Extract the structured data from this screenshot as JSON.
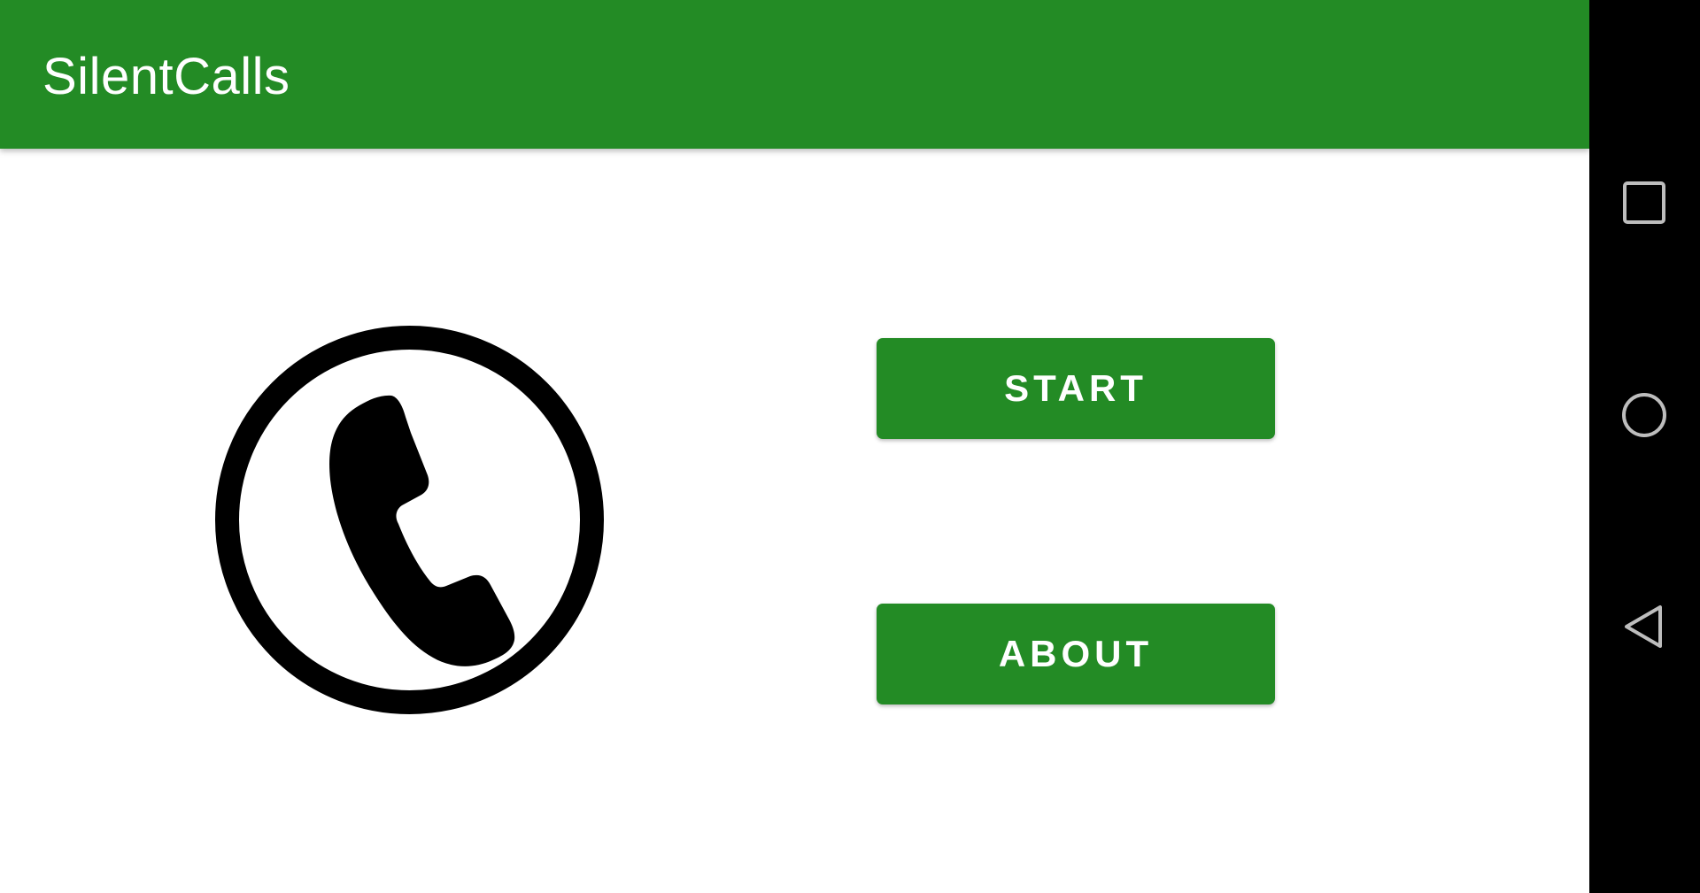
{
  "app_bar": {
    "title": "SilentCalls",
    "color": "#238b25"
  },
  "main": {
    "illustration_icon": "phone-in-circle-icon",
    "buttons": {
      "start_label": "START",
      "about_label": "ABOUT",
      "color": "#238b25"
    }
  },
  "system_nav": {
    "recents_icon": "square-icon",
    "home_icon": "circle-icon",
    "back_icon": "triangle-back-icon",
    "background": "#000000",
    "icon_color": "#bdbdbd"
  }
}
